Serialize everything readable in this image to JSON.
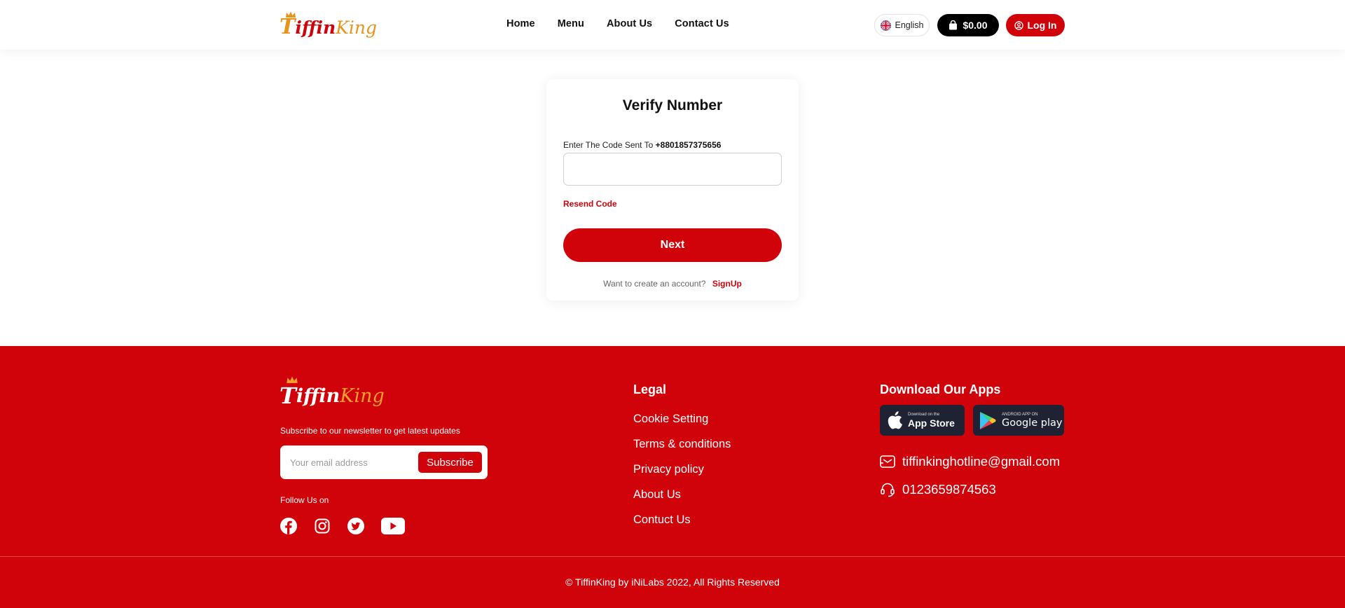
{
  "header": {
    "logo": {
      "t": "T",
      "iffin": "iffin",
      "king": "King"
    },
    "nav": [
      "Home",
      "Menu",
      "About Us",
      "Contact Us"
    ],
    "language": "English",
    "cart_total": "$0.00",
    "login_label": "Log In"
  },
  "verify": {
    "title": "Verify Number",
    "code_label": "Enter The Code Sent To",
    "phone": "+8801857375656",
    "code_value": "",
    "resend_label": "Resend Code",
    "next_label": "Next",
    "signup_prompt": "Want to create an account?",
    "signup_label": "SignUp"
  },
  "footer": {
    "logo": {
      "t": "T",
      "iffin": "iffin",
      "king": "King"
    },
    "newsletter_text": "Subscribe to our newsletter to get latest updates",
    "email_placeholder": "Your email address",
    "subscribe_label": "Subscribe",
    "follow_text": "Follow Us on",
    "socials": [
      "facebook-icon",
      "instagram-icon",
      "twitter-icon",
      "youtube-icon"
    ],
    "legal_title": "Legal",
    "legal_links": [
      "Cookie Setting",
      "Terms & conditions",
      "Privacy policy",
      "About Us",
      "Contuct Us"
    ],
    "apps_title": "Download Our Apps",
    "app_store": {
      "small": "Download on the",
      "big": "App Store"
    },
    "google_play": {
      "small": "ANDROID APP ON",
      "big": "Google play"
    },
    "email": "tiffinkinghotline@gmail.com",
    "phone": "0123659874563",
    "copyright": "© TiffinKing by iNiLabs 2022, All Rights Reserved"
  },
  "colors": {
    "brand_red": "#d0030b",
    "brand_orange": "#e8941b",
    "dark": "#000000",
    "store_badge": "#1e2233"
  }
}
